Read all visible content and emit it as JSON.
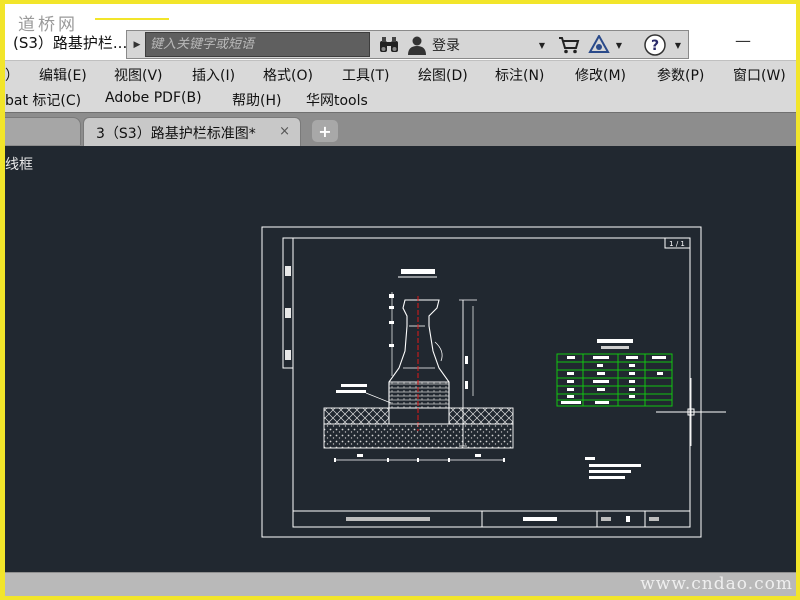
{
  "watermark_top": "道桥网",
  "watermark_bottom": "www.cndao.com",
  "window": {
    "title": "(S3）路基护栏...",
    "search_placeholder": "键入关键字或短语",
    "login_label": "登录"
  },
  "menu_row1": [
    "）",
    "编辑(E)",
    "视图(V)",
    "插入(I)",
    "格式(O)",
    "工具(T)",
    "绘图(D)",
    "标注(N)",
    "修改(M)",
    "参数(P)",
    "窗口(W)"
  ],
  "menu_row2": [
    "bat 标记(C)",
    "Adobe PDF(B)",
    "帮助(H)",
    "华网tools"
  ],
  "tabs": {
    "active_label": "3（S3）路基护栏标准图*",
    "close_glyph": "×",
    "new_glyph": "+"
  },
  "drawing": {
    "viewport_label": "线框",
    "sheet_number": "1 / 1"
  },
  "icons": {
    "search_arrow": "search-expand-icon",
    "binoculars": "binoculars-icon",
    "user": "user-icon",
    "cart": "cart-icon",
    "exchange": "exchange-icon",
    "help": "help-icon"
  },
  "colors": {
    "canvas_bg": "#212830",
    "cad_lines": "#ffffff",
    "table_lines": "#11c411",
    "centerline": "#e01818",
    "frame_border": "#f2e52a"
  }
}
